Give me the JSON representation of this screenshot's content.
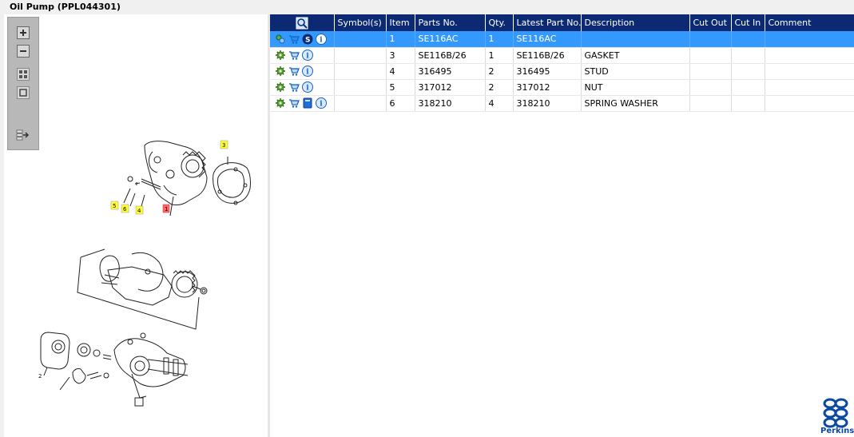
{
  "window": {
    "title": "Oil Pump (PPL044301)"
  },
  "toolbar": {
    "zoom_in": "zoom-in",
    "zoom_out": "zoom-out",
    "fit": "fit-page",
    "actual": "actual-size",
    "export": "export"
  },
  "table": {
    "headers": [
      "",
      "Symbol(s)",
      "Item",
      "Parts No.",
      "Qty.",
      "Latest Part No.",
      "Description",
      "Cut Out",
      "Cut In",
      "Comment"
    ],
    "rows": [
      {
        "item": "1",
        "part_no": "SE116AC",
        "qty": "1",
        "latest": "SE116AC",
        "description": "",
        "cut_out": "",
        "cut_in": "",
        "comment": "",
        "selected": true,
        "extra_icon": "s-badge-icon"
      },
      {
        "item": "3",
        "part_no": "SE116B/26",
        "qty": "1",
        "latest": "SE116B/26",
        "description": "GASKET",
        "cut_out": "",
        "cut_in": "",
        "comment": "",
        "selected": false,
        "extra_icon": ""
      },
      {
        "item": "4",
        "part_no": "316495",
        "qty": "2",
        "latest": "316495",
        "description": "STUD",
        "cut_out": "",
        "cut_in": "",
        "comment": "",
        "selected": false,
        "extra_icon": ""
      },
      {
        "item": "5",
        "part_no": "317012",
        "qty": "2",
        "latest": "317012",
        "description": "NUT",
        "cut_out": "",
        "cut_in": "",
        "comment": "",
        "selected": false,
        "extra_icon": ""
      },
      {
        "item": "6",
        "part_no": "318210",
        "qty": "4",
        "latest": "318210",
        "description": "SPRING WASHER",
        "cut_out": "",
        "cut_in": "",
        "comment": "",
        "selected": false,
        "extra_icon": "book-icon"
      }
    ]
  },
  "diagram": {
    "callouts": [
      "3",
      "5",
      "6",
      "4",
      "1",
      "2"
    ]
  },
  "brand": {
    "name": "Perkins",
    "color": "#0b4aa2"
  },
  "colors": {
    "header_bg": "#0b2a73",
    "selected_row": "#3399ff",
    "callout_yellow": "#ffff33",
    "callout_red": "#ff6666"
  }
}
